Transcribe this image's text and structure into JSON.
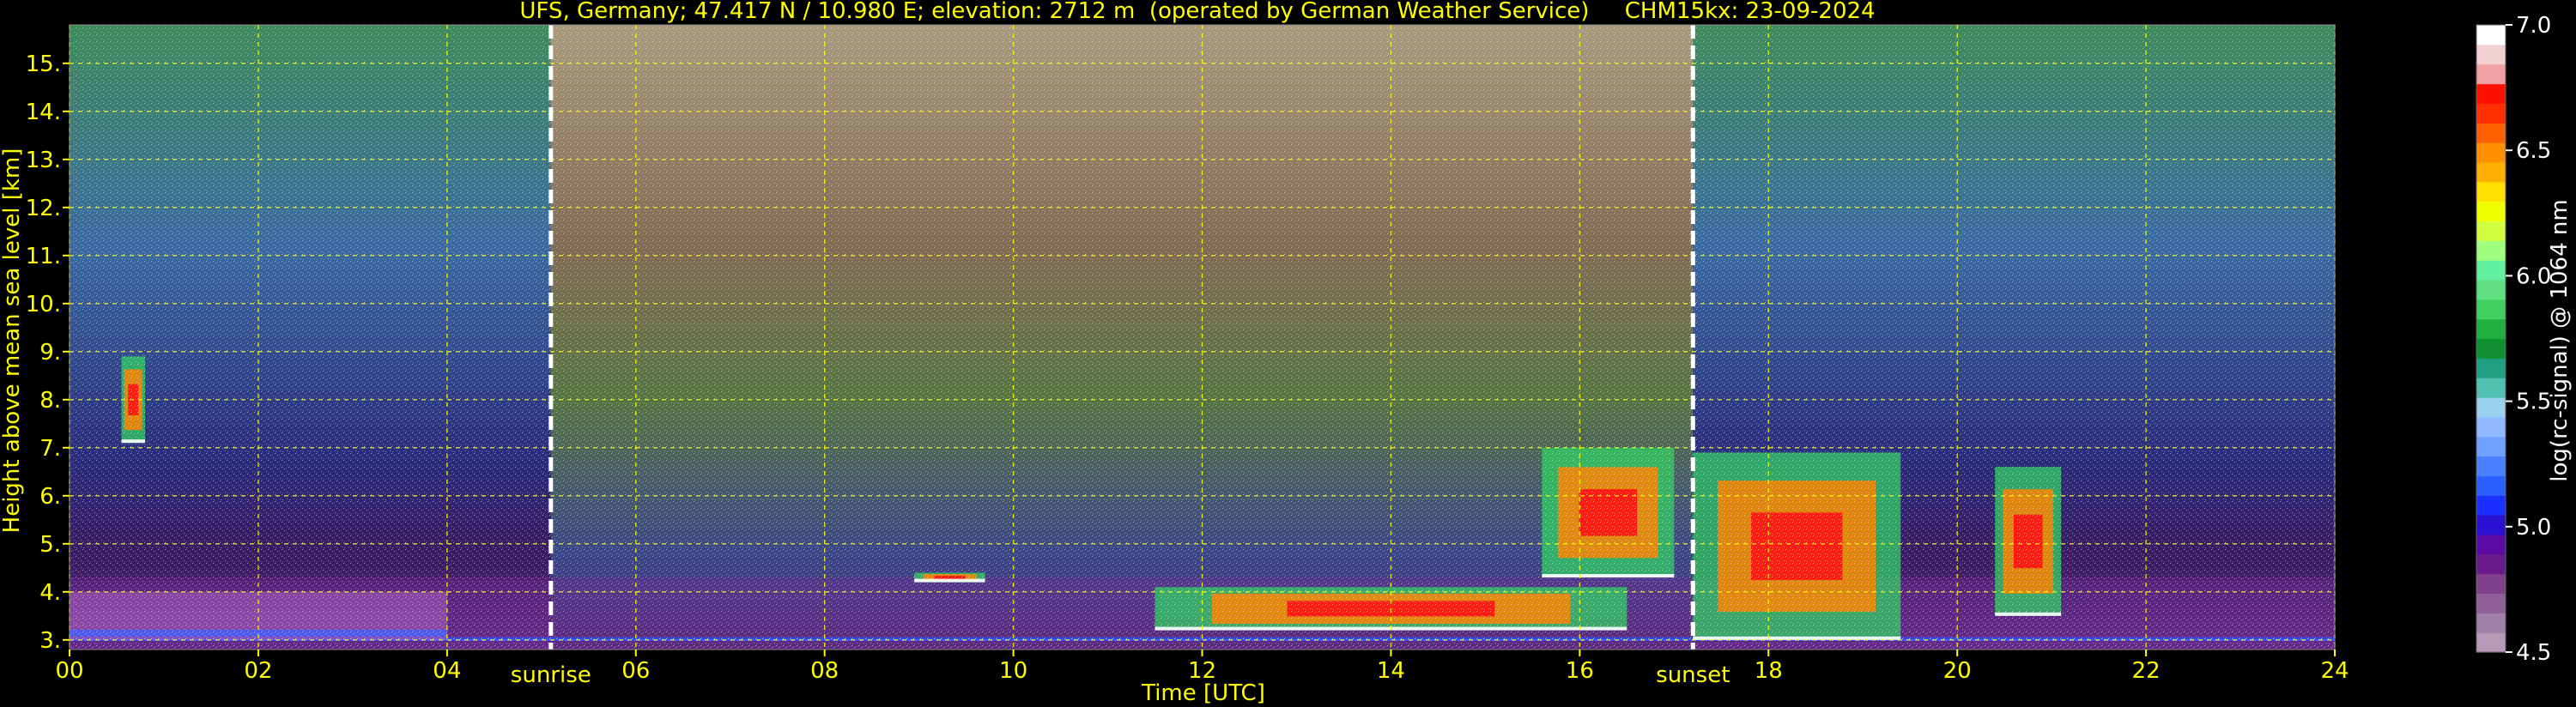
{
  "chart_data": {
    "type": "heatmap",
    "title": "UFS, Germany; 47.417 N / 10.980 E; elevation: 2712 m  (operated by German Weather Service)     CHM15kx: 23-09-2024",
    "xlabel": "Time [UTC]",
    "ylabel": "Height above mean sea level [km]",
    "xlim": [
      0,
      24
    ],
    "ylim": [
      2.8,
      15.8
    ],
    "x_ticks": [
      0,
      2,
      4,
      6,
      8,
      10,
      12,
      14,
      16,
      18,
      20,
      22,
      24
    ],
    "x_tick_labels": [
      "00",
      "02",
      "04",
      "06",
      "08",
      "10",
      "12",
      "14",
      "16",
      "18",
      "20",
      "22",
      "24"
    ],
    "y_ticks": [
      3,
      4,
      5,
      6,
      7,
      8,
      9,
      10,
      11,
      12,
      13,
      14,
      15
    ],
    "y_tick_labels": [
      "3.",
      "4.",
      "5.",
      "6.",
      "7.",
      "8.",
      "9.",
      "10.",
      "11.",
      "12.",
      "13.",
      "14.",
      "15."
    ],
    "grid": true,
    "markers": [
      {
        "label": "sunrise",
        "time": 5.1
      },
      {
        "label": "sunset",
        "time": 17.2
      }
    ],
    "colorbar": {
      "label": "log(rc-signal) @ 1064 nm",
      "range": [
        4.5,
        7.0
      ],
      "tick_values": [
        4.5,
        5.0,
        5.5,
        6.0,
        6.5,
        7.0
      ],
      "tick_labels": [
        "4.5",
        "5.0",
        "5.5",
        "6.0",
        "6.5",
        "7.0"
      ],
      "colors": [
        "#b89ab8",
        "#a080a8",
        "#90609a",
        "#80408c",
        "#6a1a8a",
        "#5a0aa0",
        "#2a10d0",
        "#1a30ff",
        "#2a60ff",
        "#4a80ff",
        "#70a0ff",
        "#90b8ff",
        "#9ad0f0",
        "#50c0b0",
        "#20a080",
        "#109030",
        "#20b040",
        "#40d060",
        "#60e080",
        "#60f0a0",
        "#a0ff80",
        "#d0ff40",
        "#f0ff00",
        "#ffe000",
        "#ffb000",
        "#ff9000",
        "#ff6000",
        "#ff3000",
        "#ff1000",
        "#f0a0a0",
        "#f0d0d0",
        "#ffffff"
      ]
    },
    "features": [
      {
        "name": "boundary layer top",
        "t0": 0.0,
        "t1": 4.0,
        "h0": 3.0,
        "h1": 4.0
      },
      {
        "name": "cloud",
        "t0": 0.55,
        "t1": 0.8,
        "h0": 7.1,
        "h1": 8.9
      },
      {
        "name": "cloud",
        "t0": 8.95,
        "t1": 9.7,
        "h0": 4.2,
        "h1": 4.4
      },
      {
        "name": "cloud",
        "t0": 11.5,
        "t1": 16.5,
        "h0": 3.2,
        "h1": 4.1
      },
      {
        "name": "cloud",
        "t0": 15.6,
        "t1": 17.0,
        "h0": 4.3,
        "h1": 7.0
      },
      {
        "name": "cloud",
        "t0": 17.2,
        "t1": 19.4,
        "h0": 3.0,
        "h1": 6.9
      },
      {
        "name": "cloud",
        "t0": 20.4,
        "t1": 21.1,
        "h0": 3.5,
        "h1": 6.6
      }
    ]
  }
}
